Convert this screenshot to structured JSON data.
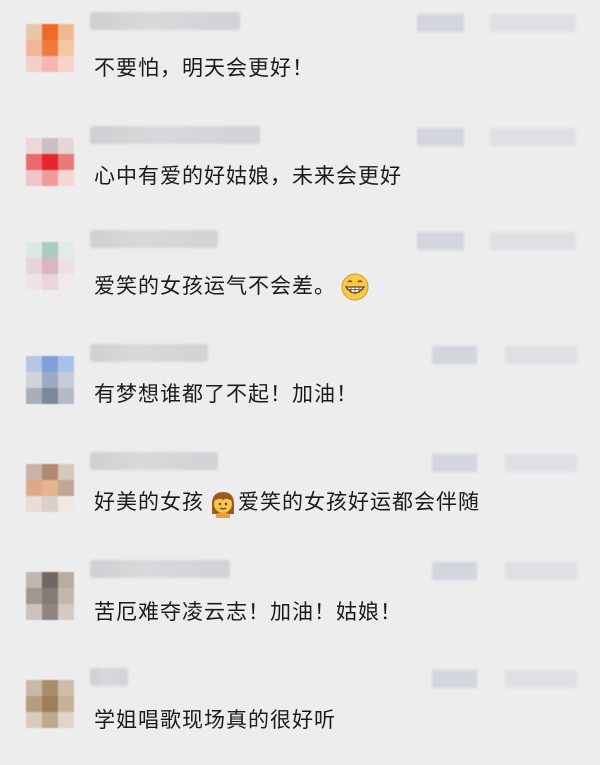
{
  "comments": [
    {
      "text": "不要怕，明天会更好！",
      "colors": [
        "#e9c6a7",
        "#ef6a2a",
        "#f2b890",
        "#f0b79a",
        "#ee7a3c",
        "#f5c7a2",
        "#f2cfc8",
        "#f4b7b0",
        "#f7d3c8"
      ]
    },
    {
      "text": "心中有爱的好姑娘，未来会更好",
      "colors": [
        "#efd6d8",
        "#c8c0c2",
        "#e6d7d7",
        "#e86a6a",
        "#e5262b",
        "#e97a7a",
        "#f1c5c7",
        "#ef9a9b",
        "#f3d6d6"
      ]
    },
    {
      "text": "爱笑的女孩运气不会差。",
      "emoji": "grin-emoji",
      "colors": [
        "#dde7e3",
        "#a8cbc2",
        "#e2ebe7",
        "#e8d3da",
        "#d8b6c2",
        "#ece0e4",
        "#efe3e8",
        "#e9d5dd",
        "#f2e9ec"
      ]
    },
    {
      "text": "有梦想谁都了不起！加油！",
      "colors": [
        "#b5c6e5",
        "#7fa0db",
        "#a9c0ea",
        "#d2d4dc",
        "#9ea9c2",
        "#c7ccd8",
        "#a9aebb",
        "#7f889b",
        "#b6bac7"
      ]
    },
    {
      "text": "好美的女孩",
      "text2": "爱笑的女孩好运都会伴随",
      "emoji": "girl-emoji",
      "colors": [
        "#c9b3a7",
        "#b28a72",
        "#d8c7bb",
        "#dfa986",
        "#e5b38e",
        "#c2a694",
        "#e7ddd8",
        "#d9cfcb",
        "#efe9e6"
      ]
    },
    {
      "text": "苦厄难夺凌云志！加油！姑娘！",
      "colors": [
        "#bdb6b1",
        "#6f6762",
        "#b8aca3",
        "#9f9792",
        "#867b74",
        "#c4b6aa",
        "#c9c2bd",
        "#8f857f",
        "#d3cbc5"
      ]
    },
    {
      "text": "学姐唱歌现场真的很好听",
      "colors": [
        "#c9b9a4",
        "#a88d6d",
        "#cdbda9",
        "#b79c7b",
        "#9d7f5c",
        "#c7b299",
        "#d8cbbb",
        "#bfa88c",
        "#e0d5c8"
      ]
    }
  ]
}
